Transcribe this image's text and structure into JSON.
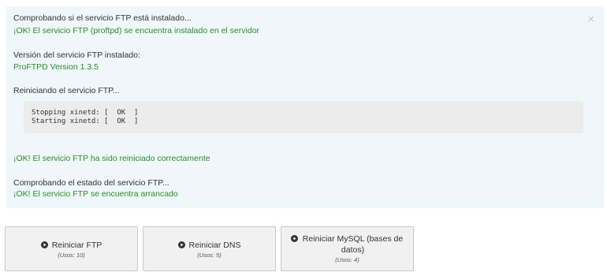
{
  "log": {
    "lines": [
      "Comprobando si el servicio FTP está instalado...",
      "¡OK! El servicio FTP (proftpd) se encuentra instalado en el servidor",
      "Versión del servicio FTP instalado:",
      "ProFTPD Version 1.3.5",
      "Reiniciando el servicio FTP...",
      "¡OK! El servicio FTP ha sido reiniciado correctamente",
      "Comprobando el estado del servicio FTP...",
      "¡OK! El servicio FTP se encuentra arrancado"
    ],
    "close_glyph": "×",
    "output": [
      "Stopping xinetd: [  OK  ]",
      "Starting xinetd: [  OK  ]"
    ],
    "colors": {
      "ok_text": "#2f8a2a",
      "panel_bg": "#eff7fb"
    }
  },
  "buttons": [
    {
      "label": "Reiniciar FTP",
      "usage": "(Usos: 10)",
      "icon": "play-circle-icon"
    },
    {
      "label": "Reiniciar DNS",
      "usage": "(Usos: 5)",
      "icon": "play-circle-icon"
    },
    {
      "label": "Reiniciar MySQL (bases de datos)",
      "usage": "(Usos: 4)",
      "icon": "play-circle-icon"
    }
  ]
}
